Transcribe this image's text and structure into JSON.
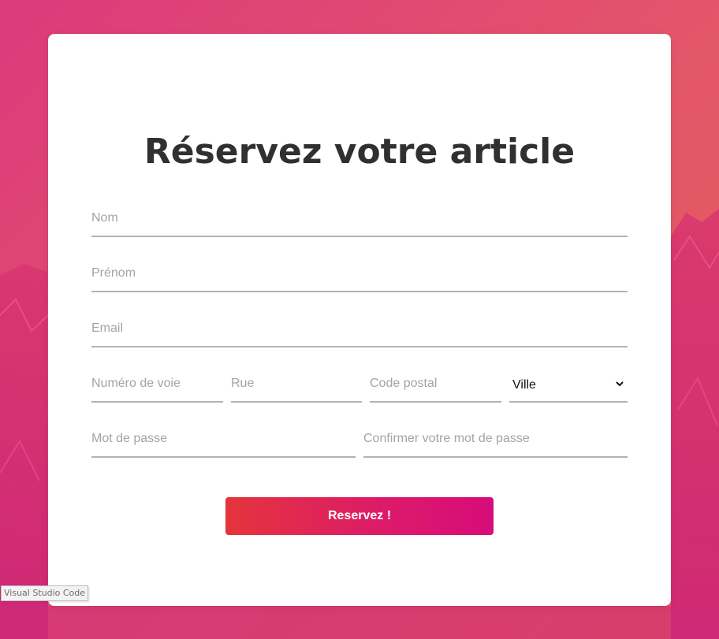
{
  "form": {
    "title": "Réservez votre article",
    "fields": {
      "nom": "Nom",
      "prenom": "Prénom",
      "email": "Email",
      "numero_voie": "Numéro de voie",
      "rue": "Rue",
      "code_postal": "Code postal",
      "ville": "Ville",
      "mot_de_passe": "Mot de passe",
      "confirmer_mot_de_passe": "Confirmer votre mot de passe"
    },
    "submit_label": "Reservez !"
  },
  "tooltip": {
    "text": "Visual Studio Code"
  },
  "colors": {
    "background_start": "#dc3a7c",
    "background_end": "#e55e55",
    "button_start": "#e4343c",
    "button_end": "#d60c7a",
    "title": "#303030"
  }
}
